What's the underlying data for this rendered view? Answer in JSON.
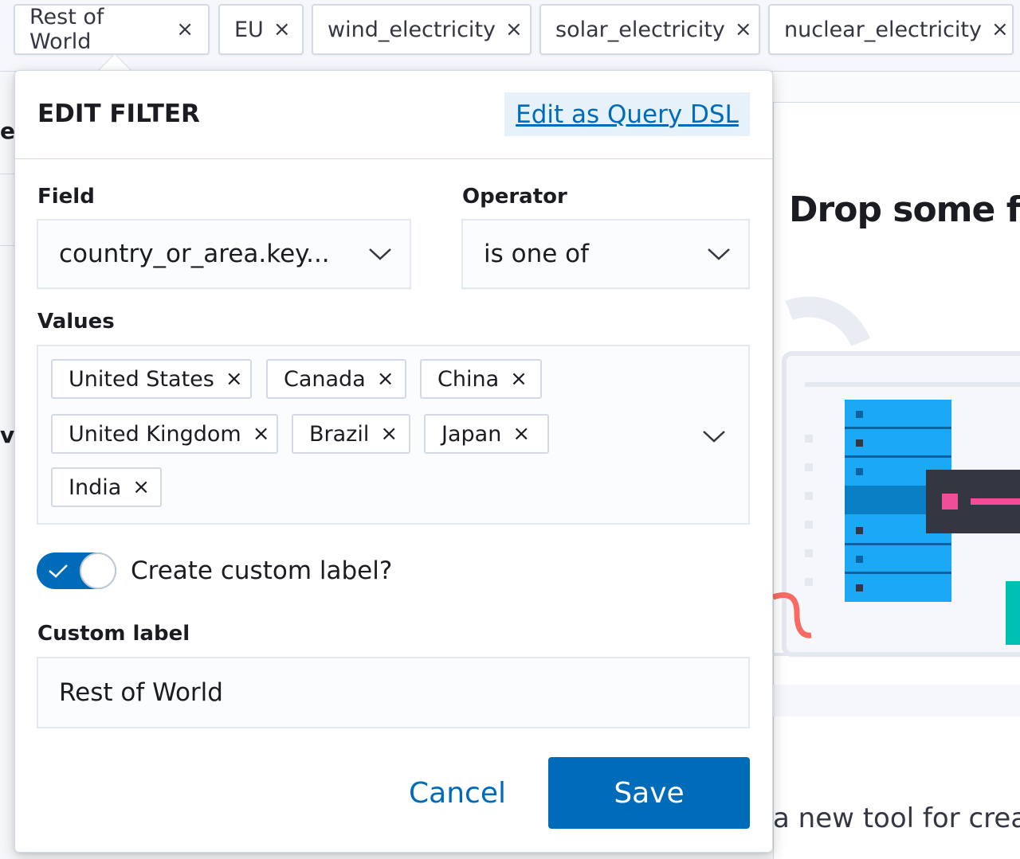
{
  "filter_bar": {
    "pills": [
      {
        "label": "Rest of World"
      },
      {
        "label": "EU"
      },
      {
        "label": "wind_electricity"
      },
      {
        "label": "solar_electricity"
      },
      {
        "label": "nuclear_electricity"
      }
    ],
    "remove_glyph": "×"
  },
  "background": {
    "heading": "Drop some fiel",
    "subtext": "a new tool for crea",
    "left_fragment_1": "e",
    "left_fragment_2": "v"
  },
  "popover": {
    "title": "EDIT FILTER",
    "query_dsl_link": "Edit as Query DSL",
    "field": {
      "label": "Field",
      "value": "country_or_area.key..."
    },
    "operator": {
      "label": "Operator",
      "value": "is one of"
    },
    "values": {
      "label": "Values",
      "chips": [
        "United States",
        "Canada",
        "China",
        "United Kingdom",
        "Brazil",
        "Japan",
        "India"
      ]
    },
    "custom_label_toggle": {
      "label": "Create custom label?",
      "checked": true
    },
    "custom_label": {
      "label": "Custom label",
      "value": "Rest of World"
    },
    "buttons": {
      "cancel": "Cancel",
      "save": "Save"
    }
  },
  "colors": {
    "primary": "#006bb8",
    "border": "#d3dae6",
    "text": "#1a1c21",
    "dsl_bg": "#e6f1fa"
  }
}
